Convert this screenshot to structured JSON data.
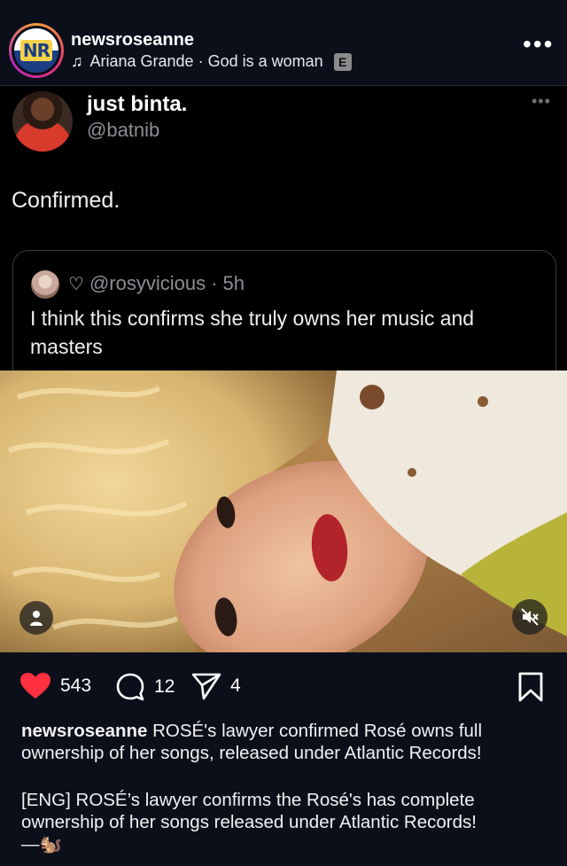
{
  "post": {
    "username": "newsroseanne",
    "avatar_text": "NR",
    "music": {
      "icon": "music-note-icon",
      "text": "Ariana Grande · God is a woman",
      "explicit_badge": "E"
    },
    "more_icon": "more-horizontal-icon"
  },
  "tweet": {
    "name": "just binta.",
    "handle": "@batnib",
    "text": "Confirmed.",
    "quote": {
      "handle": "@rosyvicious",
      "time": "· 5h",
      "text": "I think this confirms she truly owns her music and masters"
    }
  },
  "actions": {
    "likes": "543",
    "comments": "12",
    "shares": "4",
    "like_color": "#ff3040"
  },
  "caption": {
    "username": "newsroseanne",
    "text": "ROSÉ's lawyer confirmed Rosé owns full ownership of her songs, released under Atlantic Records!",
    "eng_text": " [ENG] ROSÉ’s lawyer confirms the Rosé's has complete ownership of her songs released under Atlantic Records!",
    "sign_off": "—🐿️"
  }
}
